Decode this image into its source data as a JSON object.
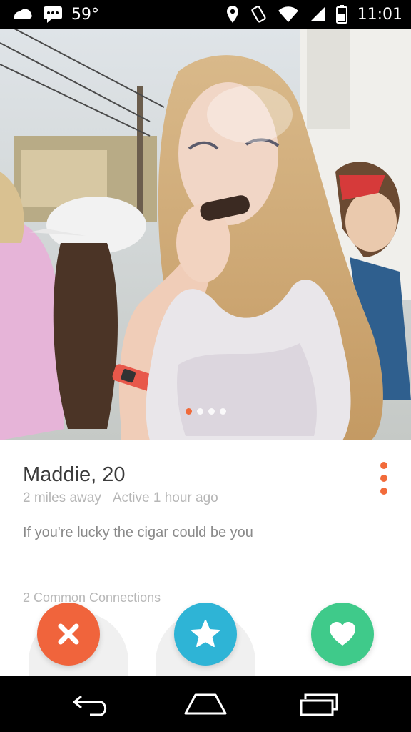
{
  "status_bar": {
    "temperature": "59°",
    "time": "11:01",
    "icons": [
      "cloud-icon",
      "message-icon",
      "location-icon",
      "vibrate-icon",
      "wifi-icon",
      "signal-icon",
      "battery-icon"
    ]
  },
  "photo": {
    "description_icon": "profile-photo",
    "page_count": 4,
    "active_page": 1
  },
  "profile": {
    "name_age": "Maddie, 20",
    "distance": "2 miles away",
    "active": "Active 1 hour ago",
    "bio": "If you're lucky the cigar could be you",
    "connections_title": "2 Common Connections"
  },
  "actions": {
    "nope_icon": "close-icon",
    "superlike_icon": "star-icon",
    "like_icon": "heart-icon"
  },
  "colors": {
    "accent": "#f26b3a",
    "nope": "#f0643c",
    "superlike": "#2eb4d6",
    "like": "#3fca8a"
  },
  "nav": {
    "icons": [
      "back-icon",
      "home-icon",
      "recents-icon"
    ]
  }
}
